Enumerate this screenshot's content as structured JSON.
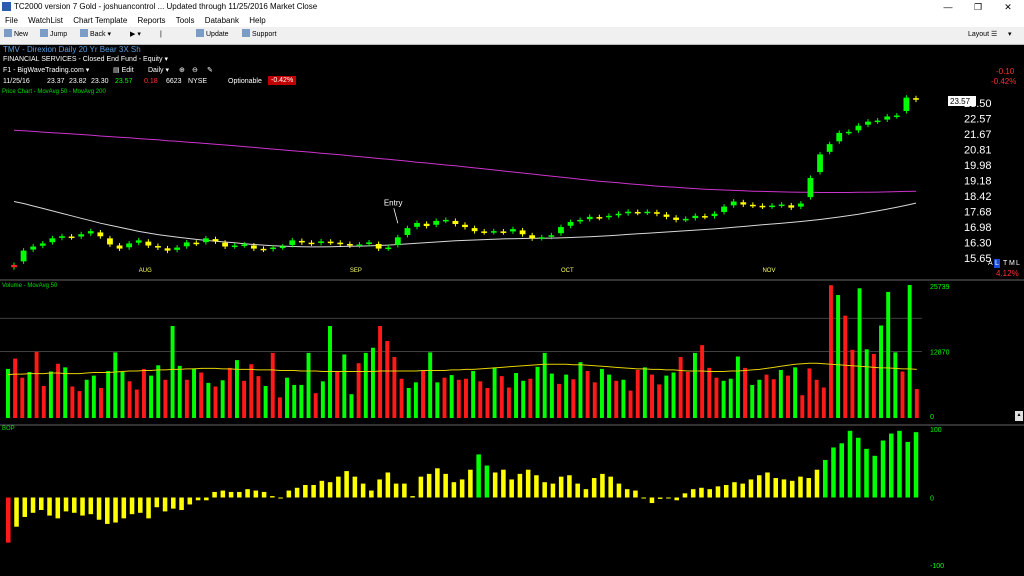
{
  "window": {
    "title": "TC2000 version 7 Gold - joshuancontrol   ... Updated through 11/25/2016  Market Close",
    "minimize_glyph": "—",
    "maximize_glyph": "❐",
    "close_glyph": "✕"
  },
  "menu": [
    "File",
    "WatchList",
    "Chart Template",
    "Reports",
    "Tools",
    "Databank",
    "Help"
  ],
  "toolbar": {
    "new_label": "New",
    "jump_label": "Jump",
    "back_label": "Back",
    "forward_label": "▶",
    "update_label": "Update",
    "support_label": "Support",
    "layout_label": "Layout",
    "arrow_down_glyph": "▾"
  },
  "chart_header": {
    "symbol_line": "TMV - Direxion Daily 20 Yr Bear 3X Sh",
    "sector_line": "FINANCIAL SERVICES - Closed End Fund - Equity ▾",
    "layout_name": "F1 - BigWaveTrading.com ▾",
    "edit_label": "Edit",
    "period": "Daily ▾",
    "date": "11/25/16",
    "open": "23.37",
    "high": "23.82",
    "low": "23.30",
    "close": "23.57",
    "change": "0.18",
    "volume": "6623",
    "exchange": "NYSE",
    "optionable": "Optionable",
    "pct_badge": "-0.42%",
    "right_change": "-0.10",
    "right_pct": "-0.42%",
    "right_pct2": "4.12%",
    "atml": [
      "A",
      "L",
      "T",
      "M",
      "L"
    ],
    "colors": {
      "accent_red": "#ff2020",
      "up": "#00ff00",
      "down": "#ffff00",
      "ma50": "#d8d8d8",
      "ma200": "#cc33cc"
    }
  },
  "price_panel": {
    "legend": "Price Chart - MovAvg 50 - MovAvg 200",
    "last_price_tag": "23.57",
    "price_ticks": [
      "23.50",
      "22.57",
      "21.67",
      "20.81",
      "19.98",
      "19.18",
      "18.42",
      "17.68",
      "16.98",
      "16.30",
      "15.65"
    ],
    "month_labels": [
      "AUG",
      "SEP",
      "OCT",
      "NOV"
    ],
    "annotation": "Entry"
  },
  "volume_panel": {
    "legend": "Volume - MovAvg 50",
    "ticks": [
      "25739",
      "12870",
      "0"
    ]
  },
  "bop_panel": {
    "legend": "BOP",
    "ticks": [
      "100",
      "0",
      "-100"
    ]
  },
  "chart_data": [
    {
      "type": "candlestick",
      "title": "TMV - Direxion Daily 20 Yr Bear 3X Sh",
      "ylim": [
        15.4,
        23.8
      ],
      "x": [
        "Jul 14",
        "Jul 15",
        "Jul 18",
        "Jul 19",
        "Jul 20",
        "Jul 21",
        "Jul 22",
        "Jul 25",
        "Jul 26",
        "Jul 27",
        "Jul 28",
        "Jul 29",
        "Aug 1",
        "Aug 2",
        "Aug 3",
        "Aug 4",
        "Aug 5",
        "Aug 8",
        "Aug 9",
        "Aug 10",
        "Aug 11",
        "Aug 12",
        "Aug 15",
        "Aug 16",
        "Aug 17",
        "Aug 18",
        "Aug 19",
        "Aug 22",
        "Aug 23",
        "Aug 24",
        "Aug 25",
        "Aug 26",
        "Aug 29",
        "Aug 30",
        "Aug 31",
        "Sep 1",
        "Sep 2",
        "Sep 6",
        "Sep 7",
        "Sep 8",
        "Sep 9",
        "Sep 12",
        "Sep 13",
        "Sep 14",
        "Sep 15",
        "Sep 16",
        "Sep 19",
        "Sep 20",
        "Sep 21",
        "Sep 22",
        "Sep 23",
        "Sep 26",
        "Sep 27",
        "Sep 28",
        "Sep 29",
        "Sep 30",
        "Oct 3",
        "Oct 4",
        "Oct 5",
        "Oct 6",
        "Oct 7",
        "Oct 10",
        "Oct 11",
        "Oct 12",
        "Oct 13",
        "Oct 14",
        "Oct 17",
        "Oct 18",
        "Oct 19",
        "Oct 20",
        "Oct 21",
        "Oct 24",
        "Oct 25",
        "Oct 26",
        "Oct 27",
        "Oct 28",
        "Oct 31",
        "Nov 1",
        "Nov 2",
        "Nov 3",
        "Nov 4",
        "Nov 7",
        "Nov 8",
        "Nov 9",
        "Nov 10",
        "Nov 11",
        "Nov 14",
        "Nov 15",
        "Nov 16",
        "Nov 17",
        "Nov 18",
        "Nov 21",
        "Nov 22",
        "Nov 23",
        "Nov 25"
      ],
      "close": [
        15.5,
        16.2,
        16.4,
        16.55,
        16.8,
        16.9,
        16.85,
        17.0,
        17.15,
        16.9,
        16.5,
        16.3,
        16.55,
        16.7,
        16.45,
        16.35,
        16.2,
        16.35,
        16.6,
        16.55,
        16.8,
        16.65,
        16.4,
        16.45,
        16.5,
        16.3,
        16.25,
        16.35,
        16.4,
        16.7,
        16.6,
        16.55,
        16.65,
        16.6,
        16.55,
        16.45,
        16.5,
        16.6,
        16.3,
        16.35,
        16.85,
        17.3,
        17.55,
        17.4,
        17.65,
        17.7,
        17.5,
        17.35,
        17.15,
        17.1,
        17.15,
        17.1,
        17.25,
        17.0,
        16.8,
        16.85,
        16.95,
        17.35,
        17.6,
        17.7,
        17.85,
        17.8,
        17.9,
        18.0,
        18.1,
        18.05,
        18.1,
        18.0,
        17.85,
        17.7,
        17.75,
        17.9,
        17.85,
        18.0,
        18.35,
        18.6,
        18.45,
        18.4,
        18.35,
        18.4,
        18.45,
        18.3,
        18.5,
        19.75,
        20.9,
        21.4,
        21.95,
        22.0,
        22.3,
        22.5,
        22.55,
        22.75,
        22.8,
        23.67,
        23.57
      ],
      "ma50": [
        18.6,
        18.5,
        18.38,
        18.26,
        18.14,
        18.02,
        17.9,
        17.78,
        17.66,
        17.54,
        17.44,
        17.34,
        17.24,
        17.14,
        17.06,
        16.98,
        16.92,
        16.86,
        16.8,
        16.75,
        16.7,
        16.66,
        16.62,
        16.58,
        16.54,
        16.5,
        16.47,
        16.44,
        16.42,
        16.4,
        16.39,
        16.38,
        16.38,
        16.39,
        16.4,
        16.41,
        16.42,
        16.43,
        16.45,
        16.47,
        16.5,
        16.53,
        16.56,
        16.59,
        16.62,
        16.65,
        16.68,
        16.7,
        16.72,
        16.74,
        16.76,
        16.77,
        16.78,
        16.79,
        16.8,
        16.8,
        16.81,
        16.82,
        16.84,
        16.86,
        16.88,
        16.9,
        16.93,
        16.96,
        16.99,
        17.02,
        17.05,
        17.08,
        17.11,
        17.14,
        17.17,
        17.2,
        17.23,
        17.26,
        17.3,
        17.34,
        17.38,
        17.42,
        17.46,
        17.5,
        17.54,
        17.58,
        17.62,
        17.67,
        17.72,
        17.78,
        17.84,
        17.91,
        17.98,
        18.06,
        18.14,
        18.23,
        18.32,
        18.42,
        18.52
      ],
      "ma200": [
        22.08,
        22.05,
        22.02,
        21.99,
        21.96,
        21.93,
        21.9,
        21.87,
        21.84,
        21.8,
        21.77,
        21.74,
        21.71,
        21.67,
        21.64,
        21.61,
        21.57,
        21.54,
        21.5,
        21.47,
        21.43,
        21.39,
        21.36,
        21.32,
        21.28,
        21.24,
        21.2,
        21.16,
        21.12,
        21.08,
        21.04,
        21.0,
        20.96,
        20.92,
        20.88,
        20.83,
        20.79,
        20.75,
        20.7,
        20.66,
        20.61,
        20.57,
        20.52,
        20.48,
        20.43,
        20.38,
        20.34,
        20.29,
        20.24,
        20.19,
        20.14,
        20.09,
        20.04,
        19.99,
        19.94,
        19.89,
        19.84,
        19.79,
        19.74,
        19.69,
        19.64,
        19.59,
        19.55,
        19.51,
        19.47,
        19.43,
        19.39,
        19.35,
        19.32,
        19.29,
        19.26,
        19.23,
        19.2,
        19.18,
        19.16,
        19.14,
        19.12,
        19.1,
        19.09,
        19.08,
        19.07,
        19.06,
        19.05,
        19.05,
        19.04,
        19.04,
        19.04,
        19.04,
        19.05,
        19.05,
        19.06,
        19.07,
        19.08,
        19.09,
        19.1
      ]
    },
    {
      "type": "bar",
      "title": "Volume",
      "ylim": [
        0,
        25739
      ],
      "values": [
        9500,
        11500,
        7800,
        8900,
        12800,
        6200,
        9000,
        10500,
        9800,
        6100,
        5200,
        7400,
        8200,
        5800,
        9100,
        12700,
        8900,
        7100,
        5500,
        9500,
        8200,
        10200,
        7400,
        17800,
        10100,
        7400,
        9600,
        8800,
        6800,
        6100,
        7300,
        9700,
        11200,
        7200,
        10400,
        8100,
        6200,
        12600,
        4000,
        7800,
        6400,
        6400,
        12600,
        4800,
        7100,
        17800,
        9100,
        12300,
        4600,
        10600,
        12600,
        13600,
        17800,
        14900,
        11800,
        7600,
        5800,
        6900,
        9200,
        12700,
        6900,
        7800,
        8300,
        7400,
        7600,
        9100,
        7100,
        5800,
        9800,
        8100,
        5900,
        8700,
        7200,
        7600,
        9900,
        12600,
        8600,
        6600,
        8400,
        7500,
        10800,
        9100,
        6900,
        9500,
        8400,
        7200,
        7400,
        5300,
        9300,
        9800,
        8400,
        6500,
        8200,
        8800,
        11800,
        8900,
        12600,
        14100,
        9700,
        7800,
        7200,
        7600,
        11900,
        9700,
        6400,
        7400,
        8400,
        7500,
        9300,
        8200,
        9800,
        4400,
        9600,
        7400,
        5900,
        25700,
        23800,
        19800,
        13200,
        25100,
        13300,
        12400,
        17900,
        24400,
        12700,
        9000,
        25739,
        5600
      ],
      "ma": [
        8400,
        8500,
        8500,
        8600,
        8600,
        8600,
        8700,
        8700,
        8600,
        8600,
        8600,
        8700,
        8800,
        8800,
        8800,
        8900,
        9000,
        9100,
        9100,
        9200,
        9200,
        9300,
        9300,
        9400,
        9400,
        9500,
        9500,
        9600,
        9600,
        9600,
        9500,
        9500,
        9400,
        9400,
        9400,
        9300,
        9300,
        9300,
        9200,
        9200,
        9200,
        9100,
        9100,
        9100,
        9000,
        9000,
        9000,
        9000,
        9000,
        9000,
        9000,
        9000,
        9100,
        9100,
        9100,
        9100,
        9100,
        9100,
        9200,
        9200,
        9200,
        9200,
        9300,
        9300,
        9400,
        9400,
        9500,
        9600,
        9700,
        9800,
        9900,
        10000,
        10100,
        10200,
        10300,
        10400,
        10400,
        10400,
        10400,
        10300,
        10300,
        10200,
        10100,
        10000,
        9900,
        9800,
        9700,
        9600,
        9500,
        9500,
        9400,
        9400,
        9300,
        9300,
        9200,
        9100,
        9100,
        9100,
        9000,
        9000,
        9000,
        9100,
        9100,
        9200,
        9300,
        9400,
        9600,
        9800,
        10000,
        10200,
        10400,
        10500,
        10600,
        10600,
        10500,
        10400,
        10300,
        10200,
        10100,
        10000,
        9900,
        9800,
        9700,
        9700,
        9600,
        9500,
        9500,
        9400
      ]
    },
    {
      "type": "bar",
      "title": "BOP",
      "ylim": [
        -100,
        100
      ],
      "values": [
        -65,
        -42,
        -28,
        -22,
        -18,
        -26,
        -30,
        -20,
        -22,
        -26,
        -24,
        -32,
        -38,
        -36,
        -30,
        -24,
        -22,
        -30,
        -14,
        -20,
        -16,
        -18,
        -10,
        -4,
        -4,
        8,
        10,
        8,
        8,
        12,
        10,
        8,
        2,
        -1,
        10,
        14,
        18,
        18,
        24,
        22,
        30,
        38,
        30,
        20,
        10,
        26,
        36,
        20,
        20,
        2,
        30,
        34,
        42,
        34,
        22,
        26,
        40,
        62,
        46,
        36,
        40,
        26,
        34,
        40,
        32,
        22,
        20,
        30,
        32,
        20,
        12,
        28,
        34,
        30,
        20,
        12,
        10,
        0,
        -8,
        -2,
        0,
        -4,
        6,
        12,
        14,
        12,
        16,
        18,
        22,
        20,
        26,
        32,
        36,
        28,
        26,
        24,
        30,
        28,
        40,
        54,
        72,
        78,
        96,
        86,
        70,
        60,
        82,
        92,
        96,
        80,
        94
      ]
    }
  ]
}
